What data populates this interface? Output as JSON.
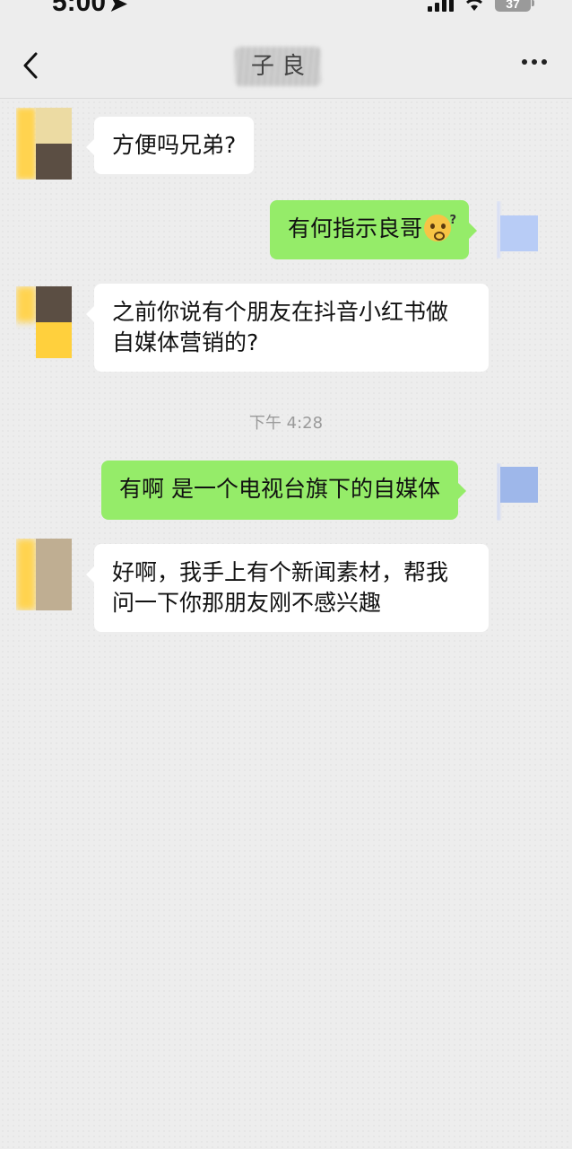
{
  "status_bar": {
    "time": "5:00",
    "battery": "37"
  },
  "nav": {
    "title": "子 良"
  },
  "messages": [
    {
      "side": "left",
      "text": "方便吗兄弟?"
    },
    {
      "side": "right",
      "text": "有何指示良哥",
      "emoji": "thinking-face-icon"
    },
    {
      "side": "left",
      "lines": [
        "之前你说有个朋友在抖音小红书做",
        "自媒体营销的?"
      ]
    },
    {
      "timestamp": "下午 4:28"
    },
    {
      "side": "right",
      "text": "有啊 是一个电视台旗下的自媒体"
    },
    {
      "side": "left",
      "lines": [
        "好啊，我手上有个新闻素材，帮我",
        "问一下你那朋友刚不感兴趣"
      ]
    }
  ],
  "colors": {
    "background": "#ededed",
    "incoming_bubble": "#ffffff",
    "outgoing_bubble": "#95ec69",
    "timestamp_text": "#9a9a9a"
  }
}
